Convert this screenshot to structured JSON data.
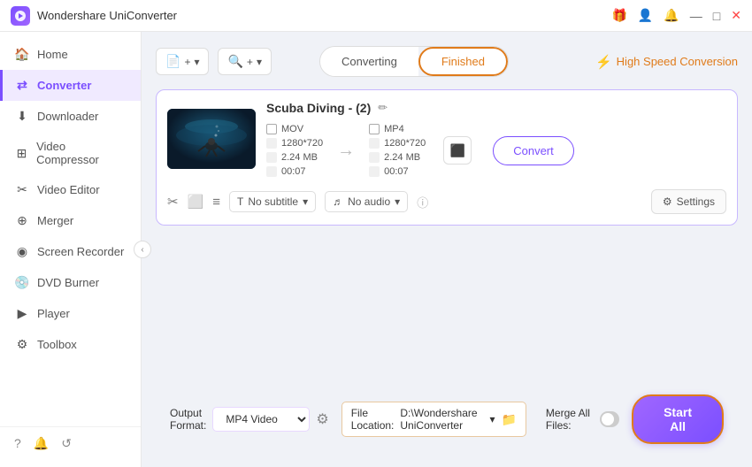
{
  "titleBar": {
    "appName": "Wondershare UniConverter",
    "controls": [
      "gift",
      "user",
      "bell",
      "minimize",
      "maximize",
      "close"
    ]
  },
  "sidebar": {
    "items": [
      {
        "id": "home",
        "label": "Home",
        "icon": "🏠",
        "active": false
      },
      {
        "id": "converter",
        "label": "Converter",
        "icon": "⇄",
        "active": true
      },
      {
        "id": "downloader",
        "label": "Downloader",
        "icon": "⬇",
        "active": false
      },
      {
        "id": "video-compressor",
        "label": "Video Compressor",
        "icon": "⊞",
        "active": false
      },
      {
        "id": "video-editor",
        "label": "Video Editor",
        "icon": "✂",
        "active": false
      },
      {
        "id": "merger",
        "label": "Merger",
        "icon": "⊕",
        "active": false
      },
      {
        "id": "screen-recorder",
        "label": "Screen Recorder",
        "icon": "◉",
        "active": false
      },
      {
        "id": "dvd-burner",
        "label": "DVD Burner",
        "icon": "💿",
        "active": false
      },
      {
        "id": "player",
        "label": "Player",
        "icon": "▶",
        "active": false
      },
      {
        "id": "toolbox",
        "label": "Toolbox",
        "icon": "⚙",
        "active": false
      }
    ],
    "footer": [
      "?",
      "🔔",
      "↺"
    ]
  },
  "toolbar": {
    "addButton": "+",
    "addButtonTitle": "Add Files",
    "settingsButton": "+",
    "tabs": {
      "converting": "Converting",
      "finished": "Finished",
      "active": "finished"
    },
    "highSpeedConversion": "High Speed Conversion"
  },
  "fileCard": {
    "title": "Scuba Diving - (2)",
    "source": {
      "format": "MOV",
      "resolution": "1280*720",
      "size": "2.24 MB",
      "duration": "00:07"
    },
    "target": {
      "format": "MP4",
      "resolution": "1280*720",
      "size": "2.24 MB",
      "duration": "00:07"
    },
    "subtitle": "No subtitle",
    "audio": "No audio",
    "convertBtn": "Convert",
    "settingsBtn": "Settings"
  },
  "bottomBar": {
    "outputFormatLabel": "Output Format:",
    "outputFormatValue": "MP4 Video",
    "fileLocationLabel": "File Location:",
    "fileLocationValue": "D:\\Wondershare UniConverter",
    "mergeAllLabel": "Merge All Files:",
    "startAllBtn": "Start All"
  }
}
